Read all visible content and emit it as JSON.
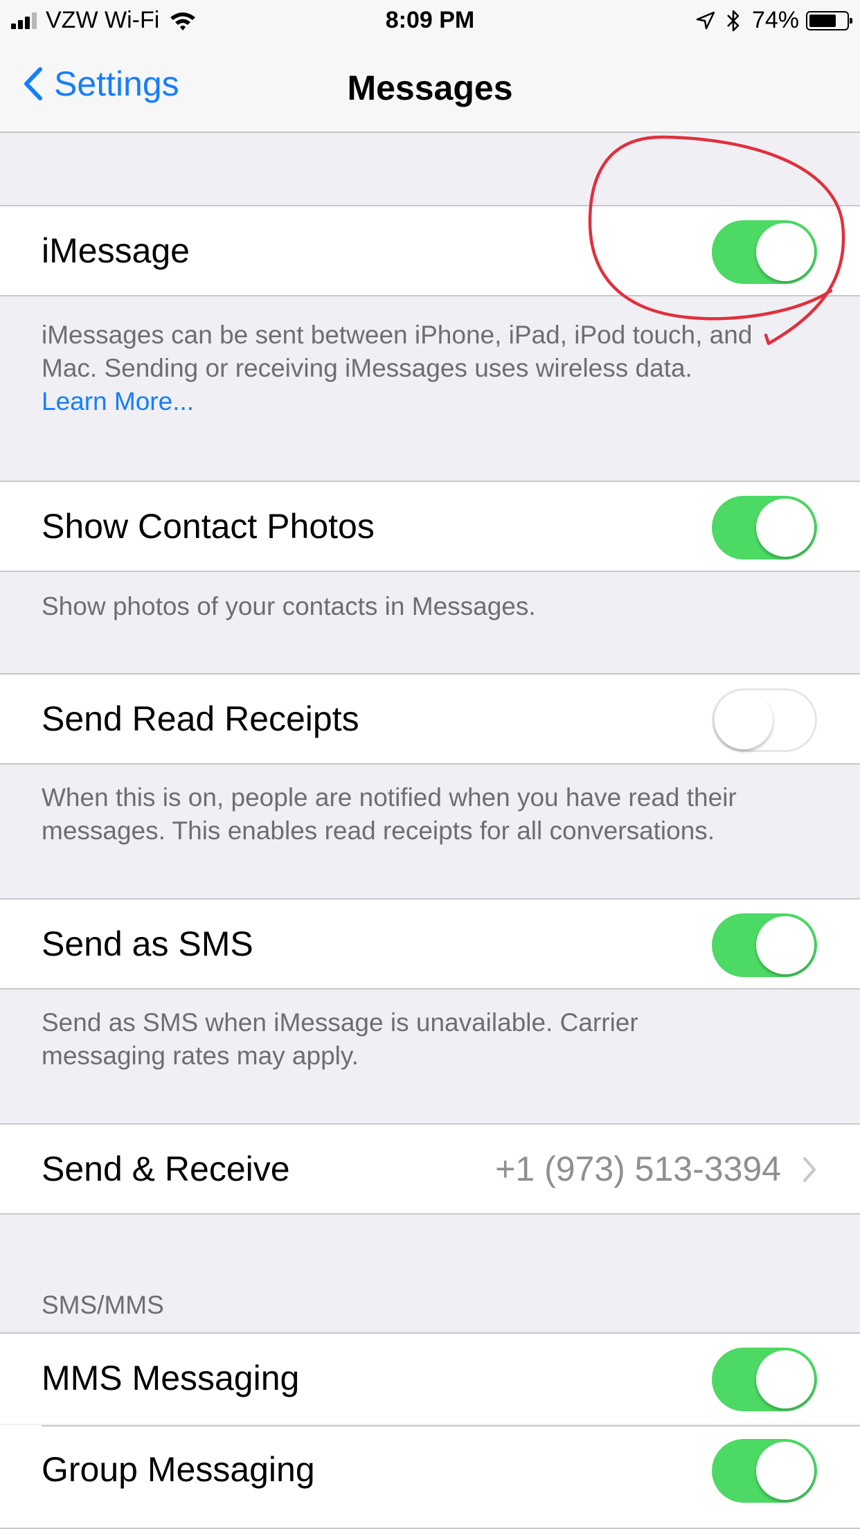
{
  "status_bar": {
    "carrier": "VZW Wi-Fi",
    "time": "8:09 PM",
    "battery": "74%",
    "battery_level": 0.74,
    "icons": [
      "signal-icon",
      "wifi-icon",
      "location-icon",
      "bluetooth-icon",
      "battery-icon"
    ]
  },
  "nav": {
    "back_label": "Settings",
    "title": "Messages"
  },
  "settings": {
    "imessage": {
      "label": "iMessage",
      "on": true
    },
    "imessage_footer": {
      "line1": "iMessages can be sent between iPhone, iPad, iPod touch, and",
      "line2": "Mac. Sending or receiving iMessages uses wireless data.",
      "link": "Learn More..."
    },
    "contact_photos": {
      "label": "Show Contact Photos",
      "on": true
    },
    "contact_photos_footer": "Show photos of your contacts in Messages.",
    "read_receipts": {
      "label": "Send Read Receipts",
      "on": false
    },
    "read_receipts_footer": {
      "line1": "When this is on, people are notified when you have read their",
      "line2": "messages. This enables read receipts for all conversations."
    },
    "send_sms": {
      "label": "Send as SMS",
      "on": true
    },
    "send_sms_footer": {
      "line1": "Send as SMS when iMessage is unavailable. Carrier",
      "line2": "messaging rates may apply."
    },
    "send_receive": {
      "label": "Send & Receive",
      "value": "+1 (973) 513-3394"
    },
    "sms_mms_header": "SMS/MMS",
    "mms": {
      "label": "MMS Messaging",
      "on": true
    },
    "group": {
      "label": "Group Messaging",
      "on": true
    }
  },
  "colors": {
    "accent": "#157efb",
    "toggle_on": "#4cd964",
    "annotation": "#e0303c"
  }
}
